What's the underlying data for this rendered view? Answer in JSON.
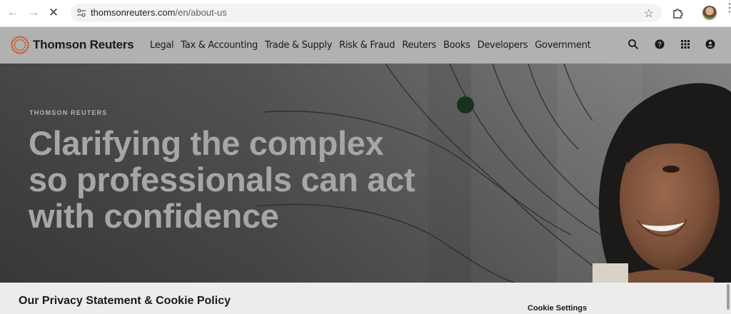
{
  "browser": {
    "url_host": "thomsonreuters.com",
    "url_path": "/en/about-us"
  },
  "header": {
    "brand": "Thomson Reuters",
    "nav": [
      "Legal",
      "Tax & Accounting",
      "Trade & Supply",
      "Risk & Fraud",
      "Reuters",
      "Books",
      "Developers",
      "Government"
    ]
  },
  "hero": {
    "eyebrow": "THOMSON REUTERS",
    "title": "Clarifying the complex so professionals can act with confidence"
  },
  "cookie": {
    "title": "Our Privacy Statement & Cookie Policy",
    "settings_label": "Cookie Settings"
  },
  "colors": {
    "header_bg": "#b1b1b1",
    "hero_text": "#a6a6a6",
    "brand_accent": "#d64000"
  }
}
